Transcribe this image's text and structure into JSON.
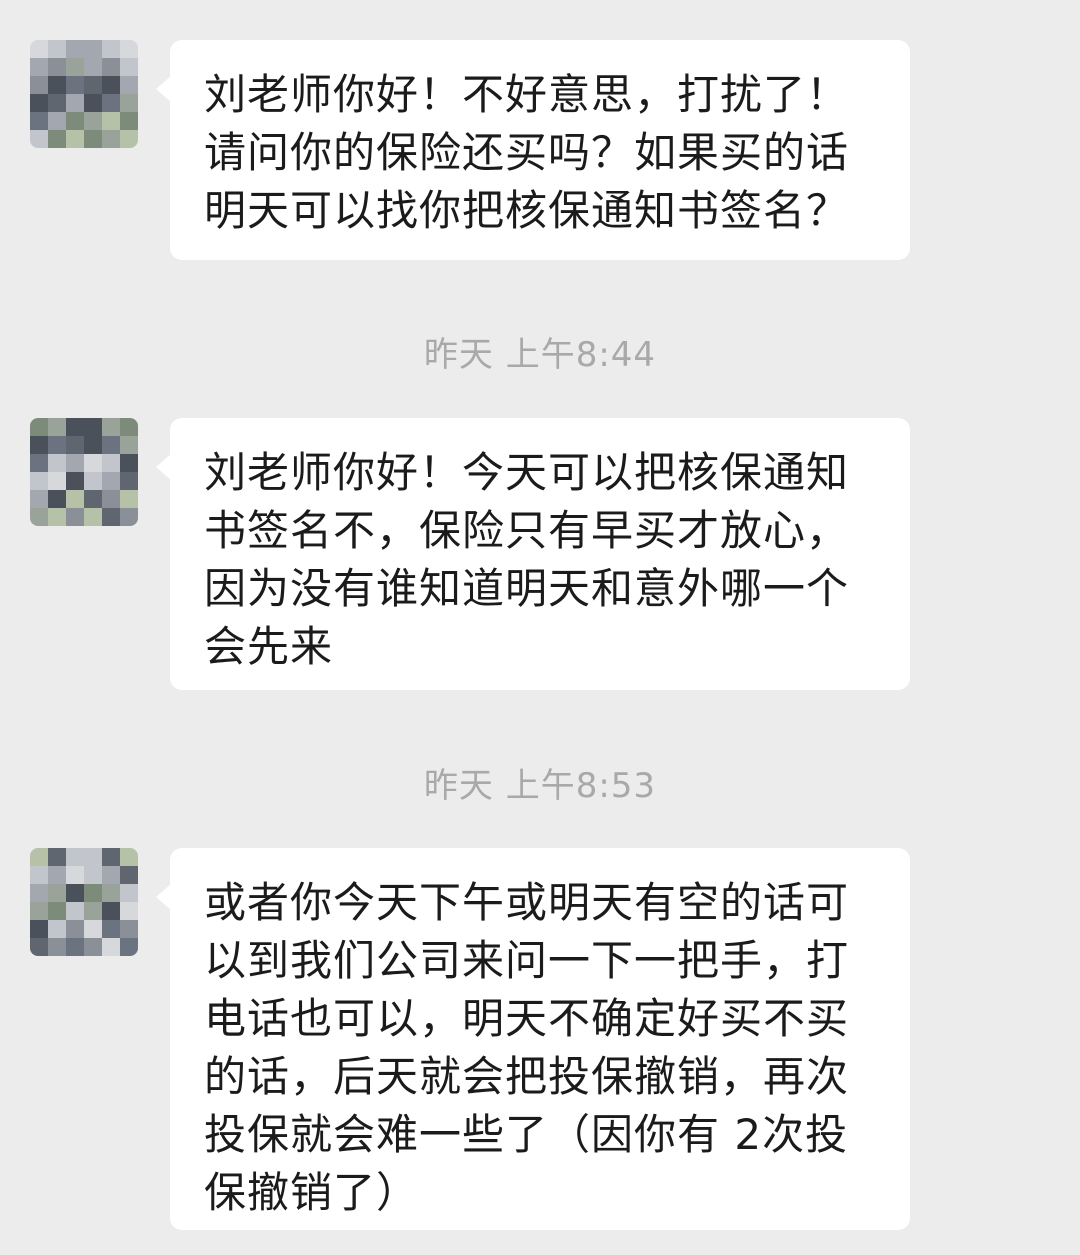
{
  "messages": [
    {
      "text": "刘老师你好！不好意思，打扰了！请问你的保险还买吗？如果买的话明天可以找你把核保通知书签名？"
    },
    {
      "text": "刘老师你好！今天可以把核保通知书签名不，保险只有早买才放心，因为没有谁知道明天和意外哪一个会先来"
    },
    {
      "text": "或者你今天下午或明天有空的话可以到我们公司来问一下一把手，打电话也可以，明天不确定好买不买的话，后天就会把投保撤销，再次投保就会难一些了（因你有 2次投保撤销了）"
    }
  ],
  "timestamps": [
    "昨天 上午8:44",
    "昨天 上午8:53"
  ],
  "avatar": {
    "description_icon": "blurred-avatar-icon",
    "colors": [
      "#8a8f98",
      "#6b7280",
      "#a3a8b0",
      "#4b515a",
      "#c2c6cc",
      "#9aa39a",
      "#5f6670",
      "#d6d8dc",
      "#7d8b7a",
      "#b5c2a8"
    ]
  },
  "theme": {
    "background": "#ececec",
    "bubble": "#ffffff",
    "text": "#1b1b1b",
    "timestamp": "#a9a9a9"
  }
}
